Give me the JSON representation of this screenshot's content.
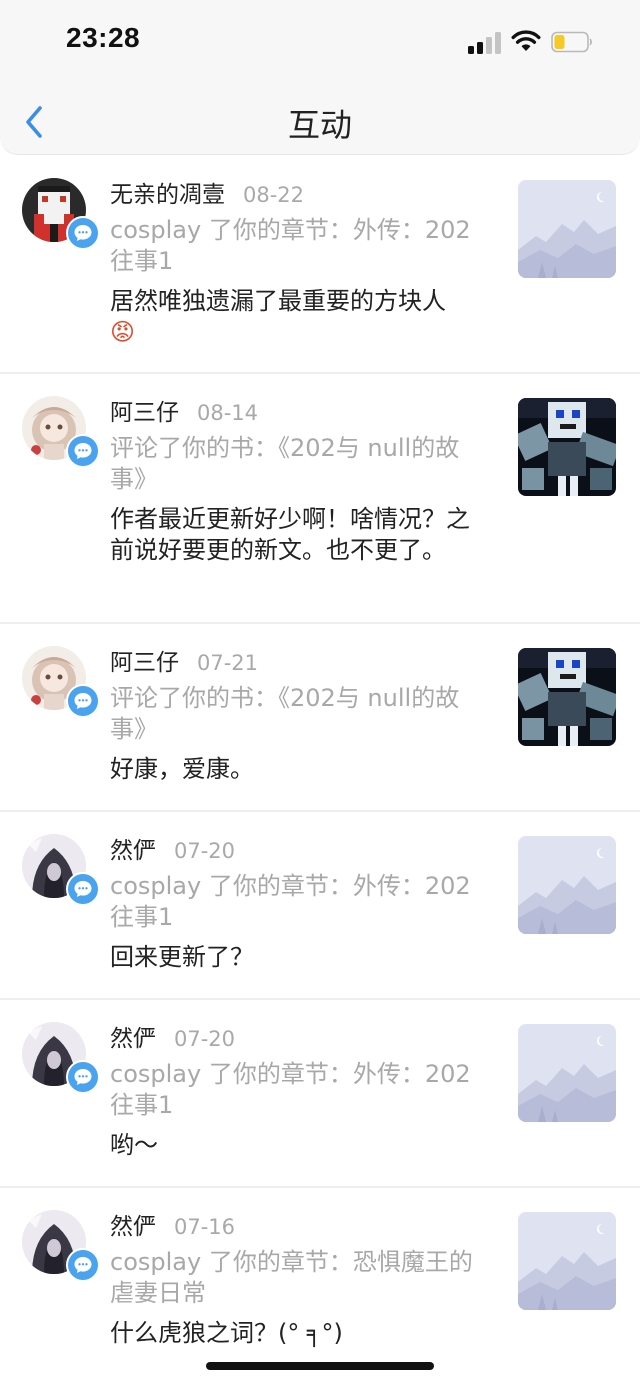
{
  "status": {
    "time": "23:28"
  },
  "header": {
    "title": "互动"
  },
  "items": [
    {
      "name": "无亲的凋壹",
      "date": "08-22",
      "desc": "cosplay 了你的章节：外传：202往事1",
      "message": "居然唯独遗漏了最重要的方块人",
      "emoji": "😡",
      "avatar": "pixel-character-avatar",
      "thumb": "placeholder-mountain-image"
    },
    {
      "name": "阿三仔",
      "date": "08-14",
      "desc": "评论了你的书：《202与 null的故事》",
      "message": "作者最近更新好少啊！啥情况？之前说好要更的新文。也不更了。",
      "avatar": "anime-girl-avatar",
      "thumb": "minecraft-character-image"
    },
    {
      "name": "阿三仔",
      "date": "07-21",
      "desc": "评论了你的书：《202与 null的故事》",
      "message": "好康，爱康。",
      "avatar": "anime-girl-avatar",
      "thumb": "minecraft-character-image"
    },
    {
      "name": "然俨",
      "date": "07-20",
      "desc": "cosplay 了你的章节：外传：202往事1",
      "message": "回来更新了？",
      "avatar": "hooded-figure-avatar",
      "thumb": "placeholder-mountain-image"
    },
    {
      "name": "然俨",
      "date": "07-20",
      "desc": "cosplay 了你的章节：外传：202往事1",
      "message": "哟～",
      "avatar": "hooded-figure-avatar",
      "thumb": "placeholder-mountain-image"
    },
    {
      "name": "然俨",
      "date": "07-16",
      "desc": "cosplay 了你的章节：恐惧魔王的虐妻日常",
      "message": "什么虎狼之词？(° ╕°)",
      "avatar": "hooded-figure-avatar",
      "thumb": "placeholder-mountain-image"
    }
  ],
  "colors": {
    "badge": "#4aa3ee",
    "accent": "#3a8ee6",
    "date": "#a9a9a9",
    "desc": "#a8a8a8"
  }
}
